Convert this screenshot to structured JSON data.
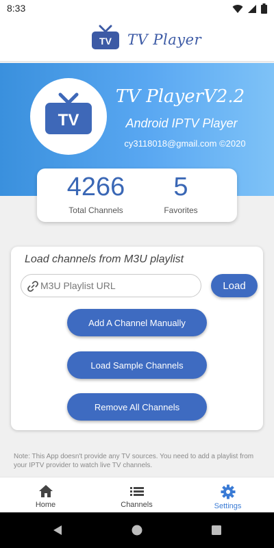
{
  "status_bar": {
    "time": "8:33"
  },
  "app_bar": {
    "title": "TV Player",
    "logo_text": "TV"
  },
  "hero": {
    "logo_text": "TV",
    "title": "TV PlayerV2.2",
    "subtitle": "Android IPTV Player",
    "contact": "cy3118018@gmail.com ©2020"
  },
  "stats": {
    "total_channels_value": "4266",
    "total_channels_label": "Total Channels",
    "favorites_value": "5",
    "favorites_label": "Favorites"
  },
  "playlist_card": {
    "heading": "Load channels from M3U playlist",
    "url_placeholder": "M3U Playlist URL",
    "url_value": "",
    "load_label": "Load",
    "add_channel_label": "Add A Channel Manually",
    "load_sample_label": "Load Sample Channels",
    "remove_all_label": "Remove All Channels"
  },
  "note": "Note: This App doesn't provide any TV sources. You need to add a playlist from your IPTV provider to watch live TV channels.",
  "bottom_nav": {
    "items": [
      {
        "label": "Home",
        "icon": "home-icon",
        "active": false
      },
      {
        "label": "Channels",
        "icon": "list-icon",
        "active": false
      },
      {
        "label": "Settings",
        "icon": "gear-icon",
        "active": true
      }
    ]
  },
  "colors": {
    "accent": "#3e6bc1",
    "active_nav": "#3a7bd5",
    "inactive_nav": "#444444",
    "hero_gradient_start": "#3a90dd",
    "hero_gradient_end": "#7ec2f7"
  }
}
